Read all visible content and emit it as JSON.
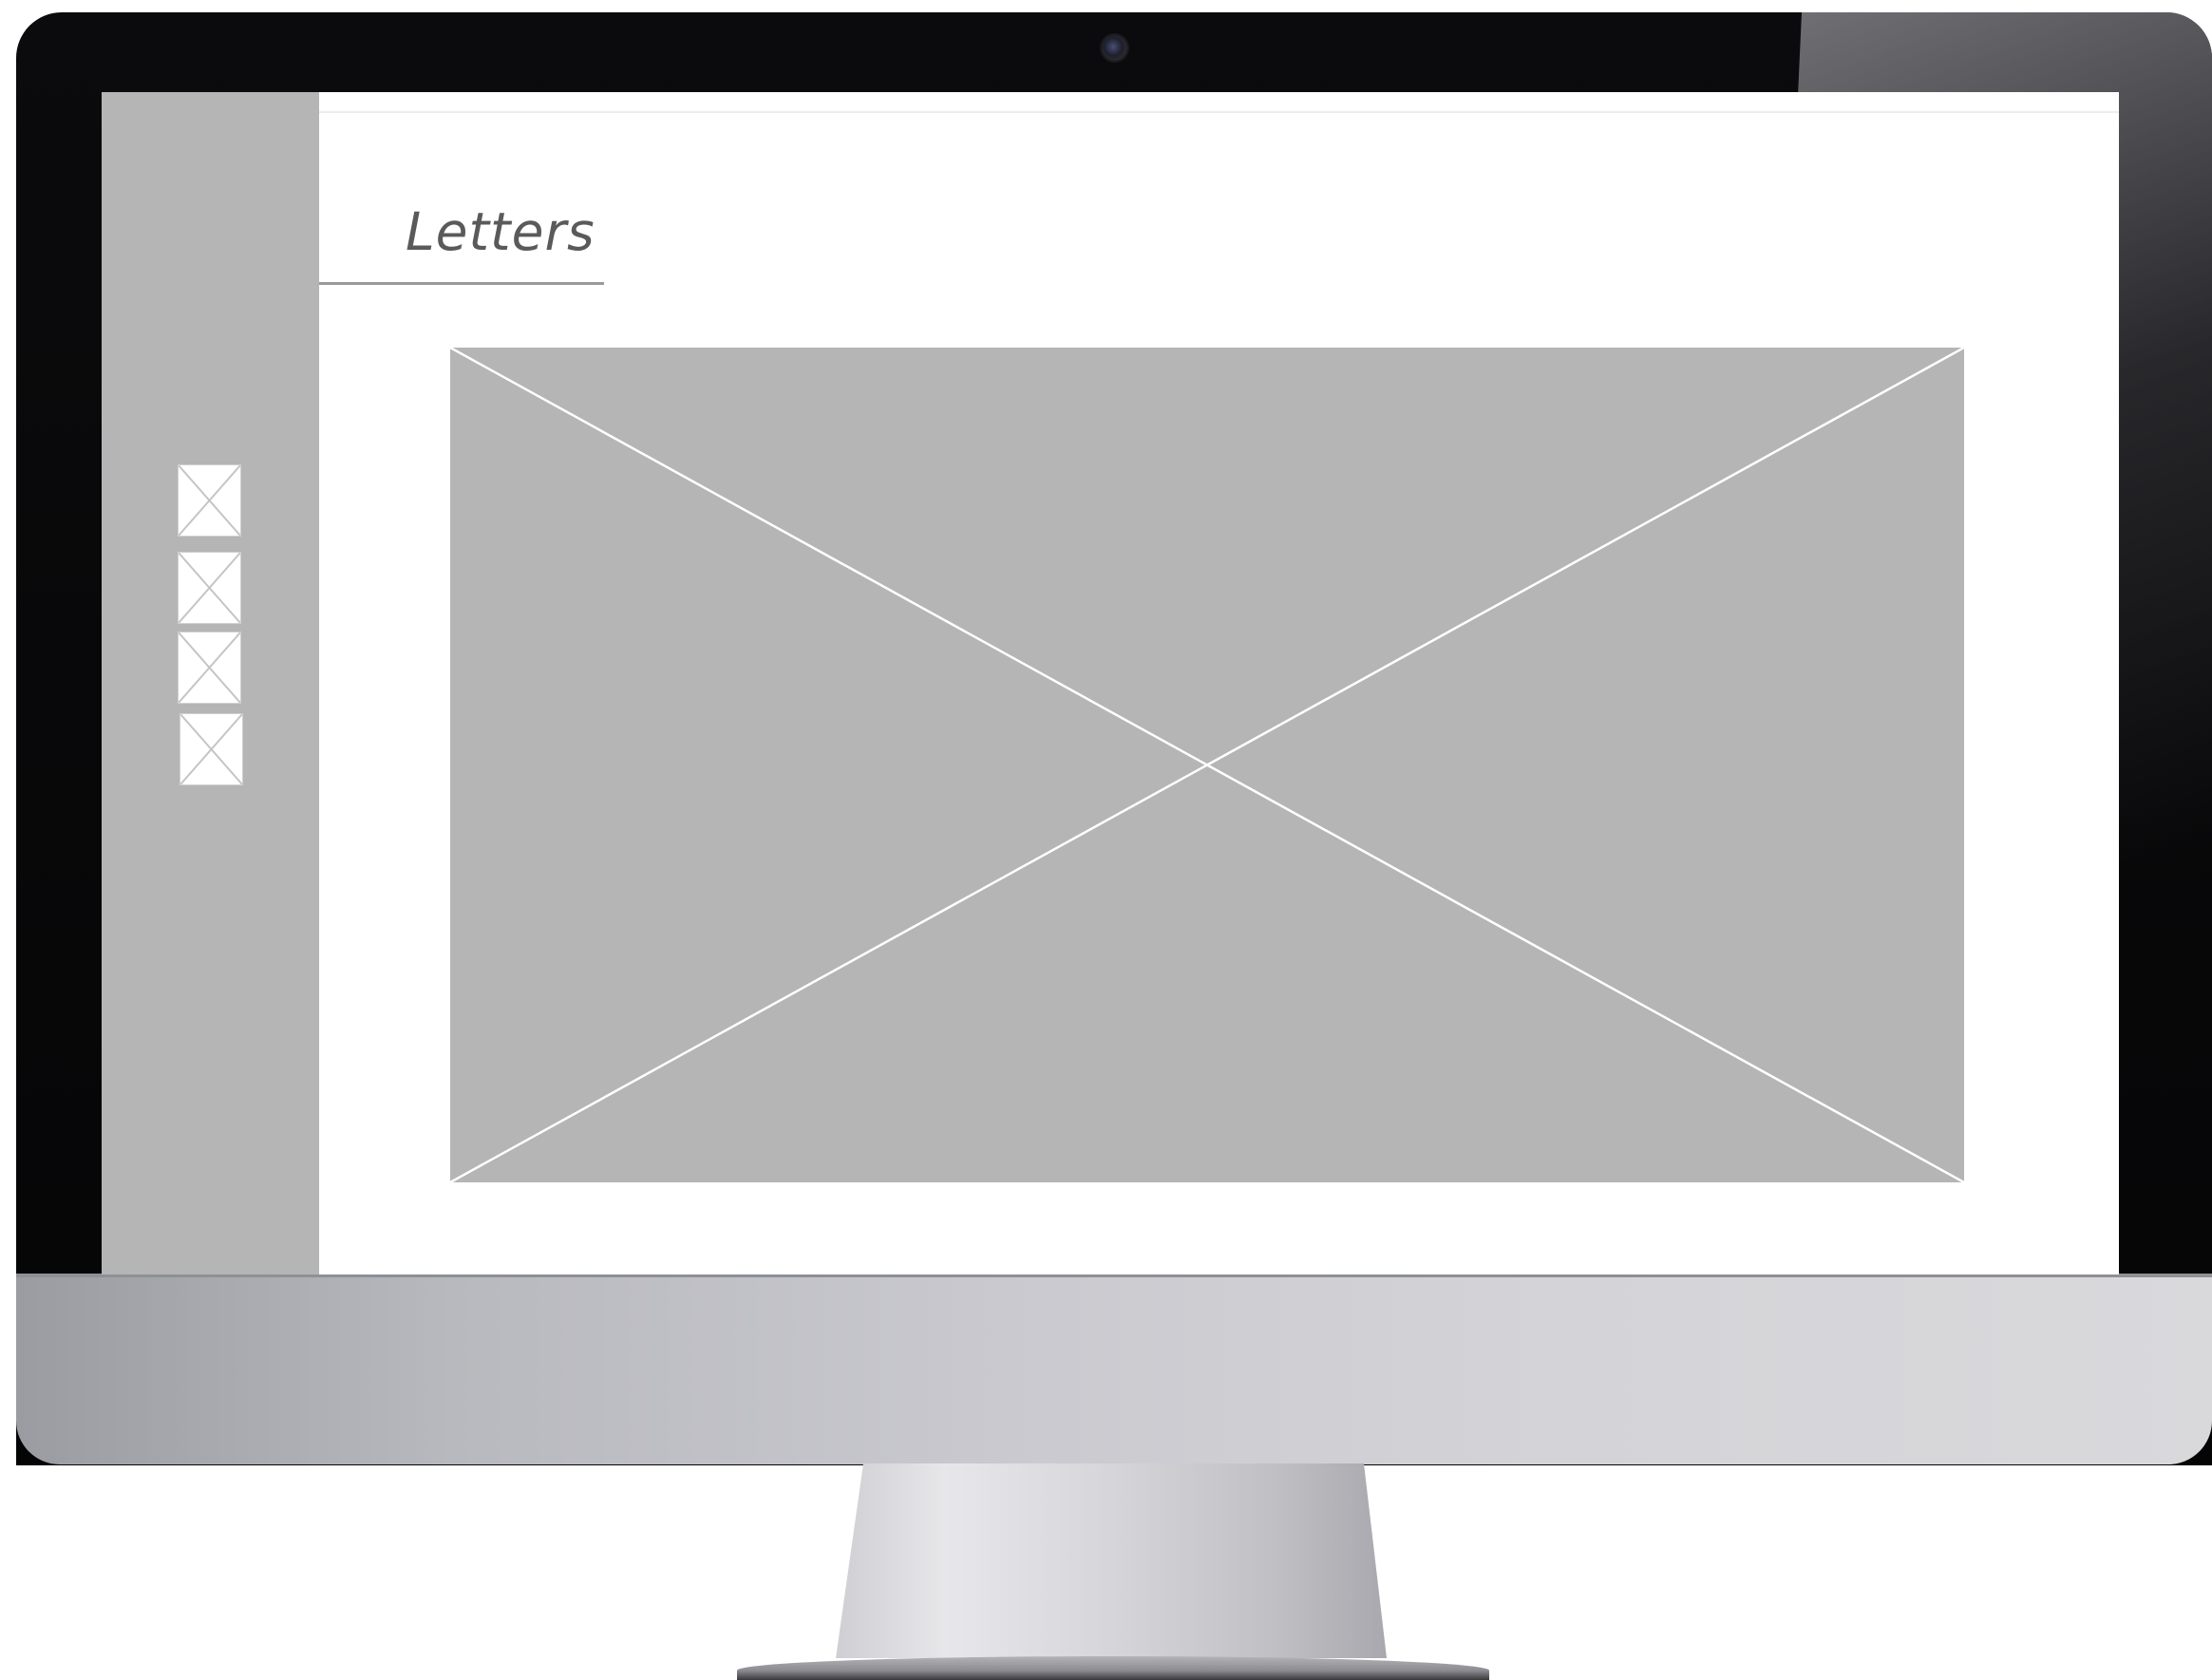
{
  "page": {
    "title": "Letters"
  },
  "sidebar": {
    "thumbnails": [
      {
        "icon": "image-placeholder-icon"
      },
      {
        "icon": "image-placeholder-icon"
      },
      {
        "icon": "image-placeholder-icon"
      },
      {
        "icon": "image-placeholder-icon"
      }
    ]
  },
  "main": {
    "image_icon": "image-placeholder-icon"
  },
  "colors": {
    "placeholder_fill": "#b5b5b5",
    "placeholder_cross": "#ffffff",
    "title_text": "#5a5a5a",
    "bezel": "#0b0b0d",
    "chin": "#c9c9cf"
  }
}
